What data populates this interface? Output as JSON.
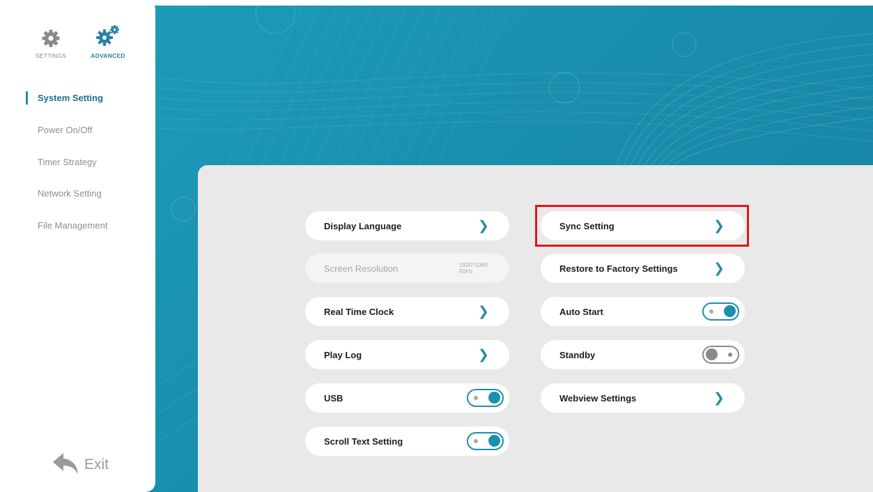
{
  "top_tabs": [
    {
      "label": "SETTINGS",
      "icon": "gear-icon",
      "active": false
    },
    {
      "label": "ADVANCED",
      "icon": "gears-icon",
      "active": true
    }
  ],
  "sidebar": {
    "items": [
      {
        "label": "System Setting",
        "active": true
      },
      {
        "label": "Power On/Off",
        "active": false
      },
      {
        "label": "Timer Strategy",
        "active": false
      },
      {
        "label": "Network Setting",
        "active": false
      },
      {
        "label": "File Management",
        "active": false
      }
    ]
  },
  "exit": {
    "label": "Exit",
    "icon": "back-arrow-icon"
  },
  "settings": {
    "left": [
      {
        "label": "Display Language",
        "control": "chevron"
      },
      {
        "label": "Screen Resolution",
        "control": "value",
        "value_line1": "1920*1080",
        "value_line2": "50Hz",
        "disabled": true
      },
      {
        "label": "Real Time Clock",
        "control": "chevron"
      },
      {
        "label": "Play Log",
        "control": "chevron"
      },
      {
        "label": "USB",
        "control": "toggle",
        "on": true
      },
      {
        "label": "Scroll Text Setting",
        "control": "toggle",
        "on": true
      }
    ],
    "right": [
      {
        "label": "Sync Setting",
        "control": "chevron",
        "highlighted": true
      },
      {
        "label": "Restore to Factory Settings",
        "control": "chevron"
      },
      {
        "label": "Auto Start",
        "control": "toggle",
        "on": true
      },
      {
        "label": "Standby",
        "control": "toggle",
        "on": false
      },
      {
        "label": "Webview Settings",
        "control": "chevron"
      }
    ]
  },
  "colors": {
    "accent": "#1a8fae",
    "highlight": "#e4141b",
    "panel": "#e9e9e9",
    "toggle_off": "#8a8a8a"
  }
}
